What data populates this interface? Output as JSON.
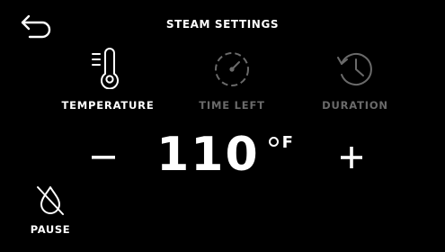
{
  "header": {
    "title": "STEAM SETTINGS",
    "back_icon": "back-arrow-icon"
  },
  "tabs": [
    {
      "label": "TEMPERATURE",
      "icon": "thermometer-icon",
      "active": true
    },
    {
      "label": "TIME LEFT",
      "icon": "timer-dial-icon",
      "active": false
    },
    {
      "label": "DURATION",
      "icon": "clock-history-icon",
      "active": false
    }
  ],
  "control": {
    "minus_symbol": "−",
    "plus_symbol": "+",
    "value": "110",
    "unit": "F",
    "unit_symbol": "degree-icon"
  },
  "footer": {
    "pause_label": "PAUSE",
    "pause_icon": "water-drop-slash-icon"
  },
  "colors": {
    "background": "#000000",
    "active_text": "#ffffff",
    "inactive_text": "#6a6a6a"
  }
}
